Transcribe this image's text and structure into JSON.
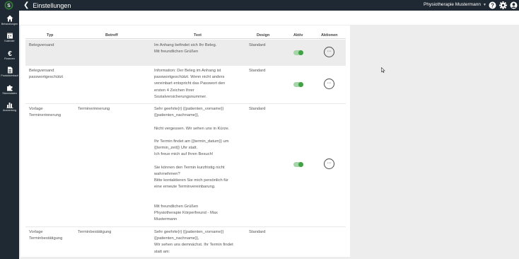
{
  "topbar": {
    "title": "Einstellungen",
    "tenant": "Physiotherapie Mustermann",
    "icons": [
      "logo-icon",
      "back-chevron-icon",
      "help-icon",
      "gear-icon",
      "user-icon"
    ]
  },
  "sidebar": {
    "items": [
      {
        "label": "Behandlungen",
        "icon": "home-icon"
      },
      {
        "label": "Kalender",
        "icon": "calendar-icon"
      },
      {
        "label": "Finanzen",
        "icon": "euro-icon"
      },
      {
        "label": "Produktverkauf",
        "icon": "document-icon"
      },
      {
        "label": "Stammdaten",
        "icon": "puzzle-icon"
      },
      {
        "label": "Auswertung",
        "icon": "bar-chart-icon"
      }
    ]
  },
  "table": {
    "headers": {
      "typ": "Typ",
      "betreff": "Betreff",
      "text": "Text",
      "design": "Design",
      "aktiv": "Aktiv",
      "aktionen": "Aktionen"
    },
    "rows": [
      {
        "typ": [
          "Belegversand"
        ],
        "betreff": [],
        "text": [
          "Im Anhang befindet sich Ihr Beleg.",
          "",
          "Mit freundlichen Grüßen"
        ],
        "design": "Standard",
        "aktiv": true,
        "actions_label": "···"
      },
      {
        "typ": [
          "Belegversand",
          "passwortgeschützt"
        ],
        "betreff": [],
        "text": [
          "Information: Der Beleg im Anhang ist",
          "passwortgeschützt. Wenn nicht anders",
          "vereinbart entspricht das Passwort den",
          "ersten 4 Zeichen Ihrer",
          "Sozialversicherungsnummer."
        ],
        "design": "Standard",
        "aktiv": true,
        "actions_label": "···"
      },
      {
        "typ": [
          "Vorlage",
          "Terminerinnerung"
        ],
        "betreff": [
          "Terminerinnerung"
        ],
        "text": [
          "Sehr geehrte{r} {{patienten_vorname}}",
          "{{patienten_nachname}},",
          "",
          "Nicht vergessen. Wir sehen uns in Kürze.",
          "",
          "Ihr Termin findet am {{termin_datum}} um",
          "{{termin_zeit}} Uhr statt.",
          "Ich freue mich auf Ihren Besuch!",
          "",
          "Sie können den Termin kurzfristig nicht",
          "wahrnehmen?",
          "Bitte kontaktieren Sie mich persönlich für",
          "eine erneute Terminvereinbarung.",
          "",
          "",
          "Mit freundlichen Grüßen",
          "Physiotherapie Körperfreund - Max",
          "Mustermann"
        ],
        "design": "Standard",
        "aktiv": true,
        "actions_label": "···"
      },
      {
        "typ": [
          "Vorlage",
          "Terminbestätigung"
        ],
        "betreff": [
          "Terminbestätigung"
        ],
        "text": [
          "Sehr geehrte{r} {{patienten_vorname}}",
          "{{patienten_nachname}},",
          "Wir sehen uns demnächst. Ihr Termin findet",
          "statt am:"
        ],
        "design": "Standard",
        "aktiv": null,
        "actions_label": ""
      }
    ]
  }
}
